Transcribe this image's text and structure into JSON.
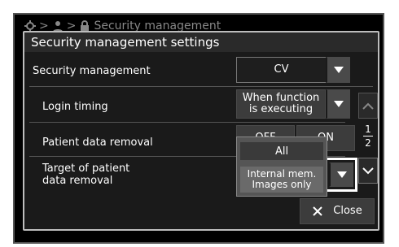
{
  "breadcrumb": {
    "current": "Security management"
  },
  "dialog": {
    "title": "Security management settings",
    "rows": [
      {
        "label": "Security management",
        "value": "CV"
      },
      {
        "label": "Login timing",
        "value": "When function\nis executing"
      },
      {
        "label": "Patient data removal",
        "off": "OFF",
        "on": "ON"
      },
      {
        "label": "Target of patient\ndata removal"
      }
    ],
    "popup": {
      "option_all": "All",
      "option_selected": "Internal mem.\nImages only"
    },
    "pager": {
      "current": "1",
      "total": "2"
    },
    "close_label": "Close"
  }
}
